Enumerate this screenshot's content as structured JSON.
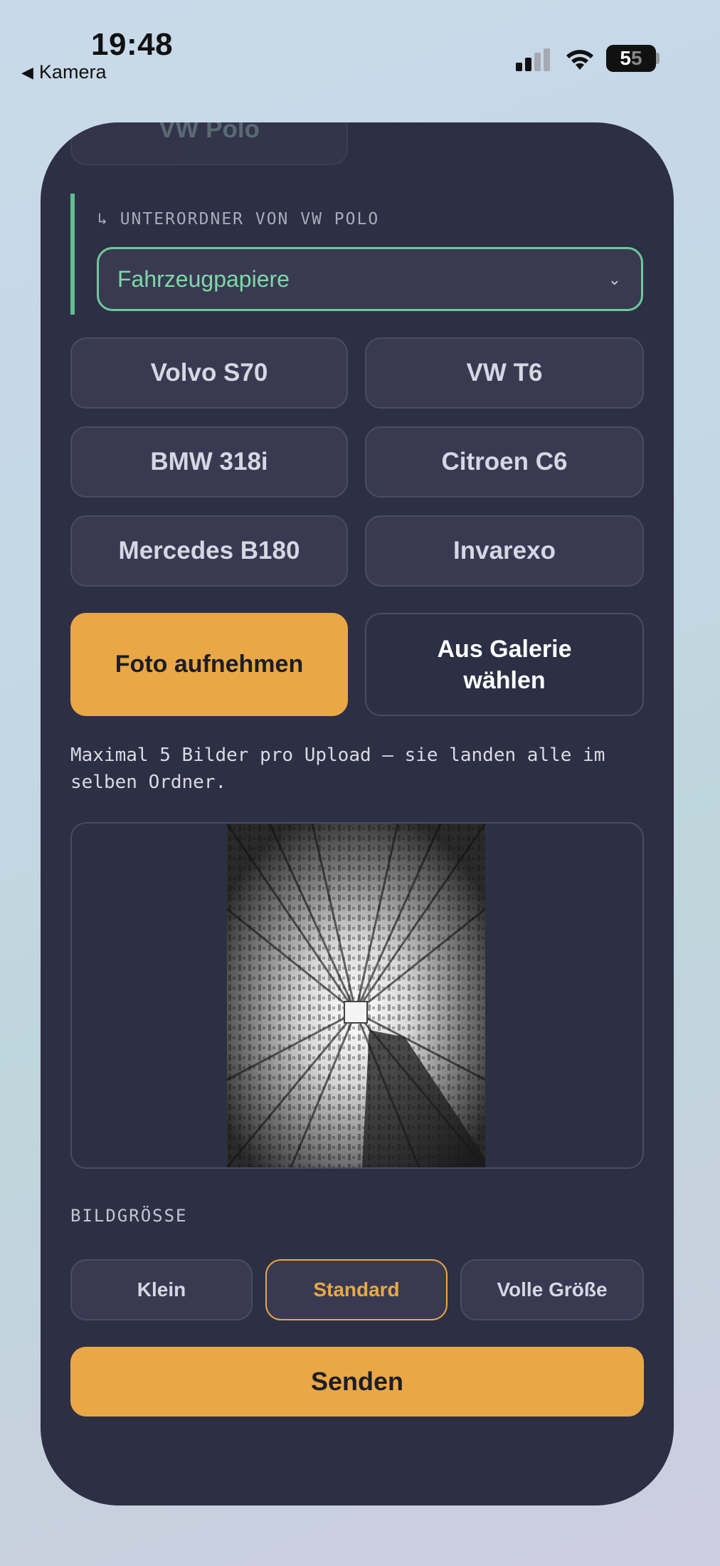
{
  "status_bar": {
    "time": "19:48",
    "back_label": "Kamera",
    "battery": "55"
  },
  "partial_folder": "VW Polo",
  "subfolder": {
    "label": "↳ UNTERORDNER VON VW POLO",
    "selected": "Fahrzeugpapiere"
  },
  "folders": [
    "Volvo S70",
    "VW T6",
    "BMW 318i",
    "Citroen C6",
    "Mercedes B180",
    "Invarexo"
  ],
  "actions": {
    "take_photo": "Foto aufnehmen",
    "gallery_line1": "Aus Galerie",
    "gallery_line2": "wählen"
  },
  "note": "Maximal 5 Bilder pro Upload – sie landen alle im selben Ordner.",
  "image_size": {
    "label": "BILDGRÖSSE",
    "options": [
      "Klein",
      "Standard",
      "Volle Größe"
    ],
    "selected": "Standard"
  },
  "send_label": "Senden",
  "colors": {
    "card_bg": "#2d2f44",
    "accent_orange": "#e9a845",
    "accent_green": "#6cc99a"
  }
}
